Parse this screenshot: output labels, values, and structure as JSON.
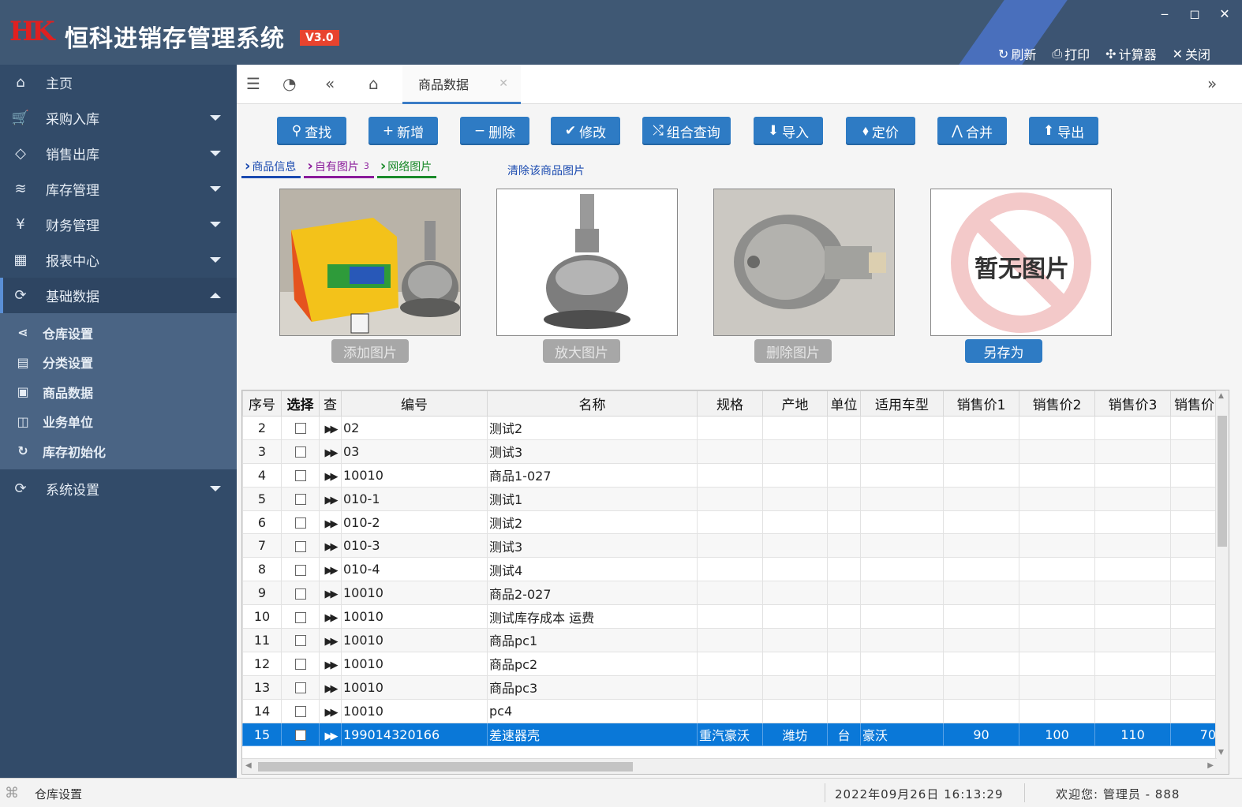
{
  "app": {
    "logo_text": "HK",
    "title": "恒科进销存管理系统",
    "version": "V3.0",
    "top_actions": [
      {
        "icon": "refresh-icon",
        "glyph": "↻",
        "label": "刷新"
      },
      {
        "icon": "print-icon",
        "glyph": "⎙",
        "label": "打印"
      },
      {
        "icon": "calculator-icon",
        "glyph": "✣",
        "label": "计算器"
      },
      {
        "icon": "close-icon",
        "glyph": "✕",
        "label": "关闭"
      }
    ]
  },
  "sidebar": {
    "items": [
      {
        "label": "主页",
        "icon": "home-icon",
        "glyph": "⌂",
        "expandable": false
      },
      {
        "label": "采购入库",
        "icon": "cart-icon",
        "glyph": "🛒",
        "expandable": true
      },
      {
        "label": "销售出库",
        "icon": "tag-icon",
        "glyph": "◇",
        "expandable": true
      },
      {
        "label": "库存管理",
        "icon": "layers-icon",
        "glyph": "≋",
        "expandable": true
      },
      {
        "label": "财务管理",
        "icon": "yen-icon",
        "glyph": "¥",
        "expandable": true
      },
      {
        "label": "报表中心",
        "icon": "dashboard-icon",
        "glyph": "▦",
        "expandable": true
      },
      {
        "label": "基础数据",
        "icon": "settings-icon",
        "glyph": "⟳",
        "expandable": true,
        "expanded": true
      }
    ],
    "submenu": [
      {
        "label": "仓库设置",
        "icon": "share-icon",
        "glyph": "⋖"
      },
      {
        "label": "分类设置",
        "icon": "calendar-icon",
        "glyph": "▤"
      },
      {
        "label": "商品数据",
        "icon": "image-icon",
        "glyph": "▣"
      },
      {
        "label": "业务单位",
        "icon": "columns-icon",
        "glyph": "◫"
      },
      {
        "label": "库存初始化",
        "icon": "refresh-icon",
        "glyph": "↻"
      }
    ],
    "footer_item": {
      "label": "系统设置",
      "icon": "system-icon",
      "glyph": "⟳"
    }
  },
  "tabs": [
    {
      "label": "商品数据",
      "active": true
    }
  ],
  "toolbar": [
    {
      "label": "查找",
      "glyph": "⚲",
      "icon": "search-icon"
    },
    {
      "label": "新增",
      "glyph": "+",
      "icon": "plus-icon"
    },
    {
      "label": "删除",
      "glyph": "−",
      "icon": "minus-icon"
    },
    {
      "label": "修改",
      "glyph": "✔",
      "icon": "check-icon"
    },
    {
      "label": "组合查询",
      "glyph": "⤭",
      "icon": "shuffle-icon"
    },
    {
      "label": "导入",
      "glyph": "⬇",
      "icon": "import-icon"
    },
    {
      "label": "定价",
      "glyph": "⬧",
      "icon": "price-tag-icon"
    },
    {
      "label": "合并",
      "glyph": "⋀",
      "icon": "merge-icon"
    },
    {
      "label": "导出",
      "glyph": "⬆",
      "icon": "export-icon"
    }
  ],
  "subtabs": [
    {
      "label": "商品信息",
      "color": "#1a4ab0",
      "count": ""
    },
    {
      "label": "自有图片",
      "color": "#8a1a9a",
      "count": "3"
    },
    {
      "label": "网络图片",
      "color": "#1a8a2a",
      "count": ""
    }
  ],
  "clear_link": "清除该商品图片",
  "images": {
    "buttons": [
      "添加图片",
      "放大图片",
      "删除图片",
      "另存为"
    ],
    "no_image_text": "暂无图片"
  },
  "grid": {
    "columns": [
      "序号",
      "选择",
      "查",
      "编号",
      "名称",
      "规格",
      "产地",
      "单位",
      "适用车型",
      "销售价1",
      "销售价2",
      "销售价3",
      "销售价"
    ],
    "rows": [
      {
        "seq": "2",
        "code": "02",
        "name": "测试2",
        "spec": "",
        "origin": "",
        "unit": "",
        "model": "",
        "p1": "",
        "p2": "",
        "p3": "",
        "p4": ""
      },
      {
        "seq": "3",
        "code": "03",
        "name": "测试3",
        "spec": "",
        "origin": "",
        "unit": "",
        "model": "",
        "p1": "",
        "p2": "",
        "p3": "",
        "p4": ""
      },
      {
        "seq": "4",
        "code": "10010",
        "name": "商品1-027",
        "spec": "",
        "origin": "",
        "unit": "",
        "model": "",
        "p1": "",
        "p2": "",
        "p3": "",
        "p4": ""
      },
      {
        "seq": "5",
        "code": "010-1",
        "name": "测试1",
        "spec": "",
        "origin": "",
        "unit": "",
        "model": "",
        "p1": "",
        "p2": "",
        "p3": "",
        "p4": ""
      },
      {
        "seq": "6",
        "code": "010-2",
        "name": "测试2",
        "spec": "",
        "origin": "",
        "unit": "",
        "model": "",
        "p1": "",
        "p2": "",
        "p3": "",
        "p4": ""
      },
      {
        "seq": "7",
        "code": "010-3",
        "name": "测试3",
        "spec": "",
        "origin": "",
        "unit": "",
        "model": "",
        "p1": "",
        "p2": "",
        "p3": "",
        "p4": ""
      },
      {
        "seq": "8",
        "code": "010-4",
        "name": "测试4",
        "spec": "",
        "origin": "",
        "unit": "",
        "model": "",
        "p1": "",
        "p2": "",
        "p3": "",
        "p4": ""
      },
      {
        "seq": "9",
        "code": "10010",
        "name": "商品2-027",
        "spec": "",
        "origin": "",
        "unit": "",
        "model": "",
        "p1": "",
        "p2": "",
        "p3": "",
        "p4": ""
      },
      {
        "seq": "10",
        "code": "10010",
        "name": "测试库存成本 运费",
        "spec": "",
        "origin": "",
        "unit": "",
        "model": "",
        "p1": "",
        "p2": "",
        "p3": "",
        "p4": ""
      },
      {
        "seq": "11",
        "code": "10010",
        "name": "商品pc1",
        "spec": "",
        "origin": "",
        "unit": "",
        "model": "",
        "p1": "",
        "p2": "",
        "p3": "",
        "p4": ""
      },
      {
        "seq": "12",
        "code": "10010",
        "name": "商品pc2",
        "spec": "",
        "origin": "",
        "unit": "",
        "model": "",
        "p1": "",
        "p2": "",
        "p3": "",
        "p4": ""
      },
      {
        "seq": "13",
        "code": "10010",
        "name": "商品pc3",
        "spec": "",
        "origin": "",
        "unit": "",
        "model": "",
        "p1": "",
        "p2": "",
        "p3": "",
        "p4": ""
      },
      {
        "seq": "14",
        "code": "10010",
        "name": "pc4",
        "spec": "",
        "origin": "",
        "unit": "",
        "model": "",
        "p1": "",
        "p2": "",
        "p3": "",
        "p4": ""
      },
      {
        "seq": "15",
        "code": "199014320166",
        "name": "差速器壳",
        "spec": "重汽豪沃",
        "origin": "潍坊",
        "unit": "台",
        "model": "豪沃",
        "p1": "90",
        "p2": "100",
        "p3": "110",
        "p4": "70",
        "selected": true
      }
    ]
  },
  "status": {
    "current": "仓库设置",
    "datetime": "2022年09月26日 16:13:29",
    "user": "欢迎您: 管理员 - 888"
  },
  "colors": {
    "titlebar": "#3f5874",
    "sidebar": "#324b69",
    "accent": "#2e7bc4",
    "selected_row": "#0a78d8",
    "version_badge": "#e8432e"
  }
}
